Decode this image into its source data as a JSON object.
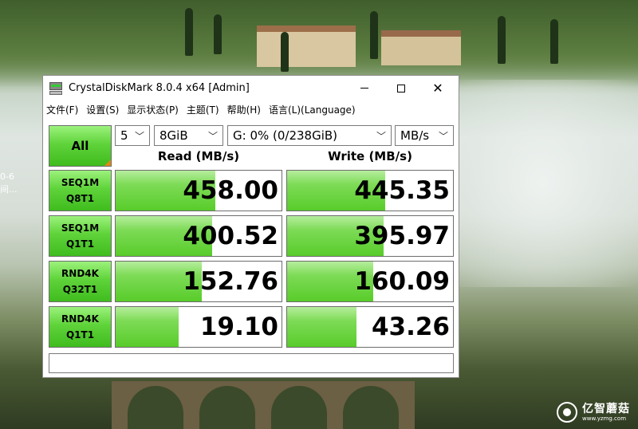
{
  "window": {
    "title": "CrystalDiskMark 8.0.4 x64 [Admin]",
    "close_glyph": "✕"
  },
  "menu": [
    {
      "label": "文件(F)"
    },
    {
      "label": "设置(S)"
    },
    {
      "label": "显示状态(P)"
    },
    {
      "label": "主题(T)"
    },
    {
      "label": "帮助(H)"
    },
    {
      "label": "语言(L)(Language)"
    }
  ],
  "controls": {
    "all_label": "All",
    "count": "5",
    "size": "8GiB",
    "drive": "G: 0% (0/238GiB)",
    "unit": "MB/s"
  },
  "headers": {
    "read": "Read (MB/s)",
    "write": "Write (MB/s)"
  },
  "tests": [
    {
      "line1": "SEQ1M",
      "line2": "Q8T1",
      "read": "458.00",
      "write": "445.35",
      "read_level": 0.6,
      "write_level": 0.59
    },
    {
      "line1": "SEQ1M",
      "line2": "Q1T1",
      "read": "400.52",
      "write": "395.97",
      "read_level": 0.58,
      "write_level": 0.58
    },
    {
      "line1": "RND4K",
      "line2": "Q32T1",
      "read": "152.76",
      "write": "160.09",
      "read_level": 0.52,
      "write_level": 0.52
    },
    {
      "line1": "RND4K",
      "line2": "Q1T1",
      "read": "19.10",
      "write": "43.26",
      "read_level": 0.38,
      "write_level": 0.42
    }
  ],
  "desktop": {
    "icon_line1": "0-6",
    "icon_line2": "间..."
  },
  "watermark": {
    "title": "亿智蘑菇",
    "url": "www.yzmg.com"
  },
  "colors": {
    "accent_green": "#58cc2a",
    "corner_orange": "#e08a16"
  }
}
